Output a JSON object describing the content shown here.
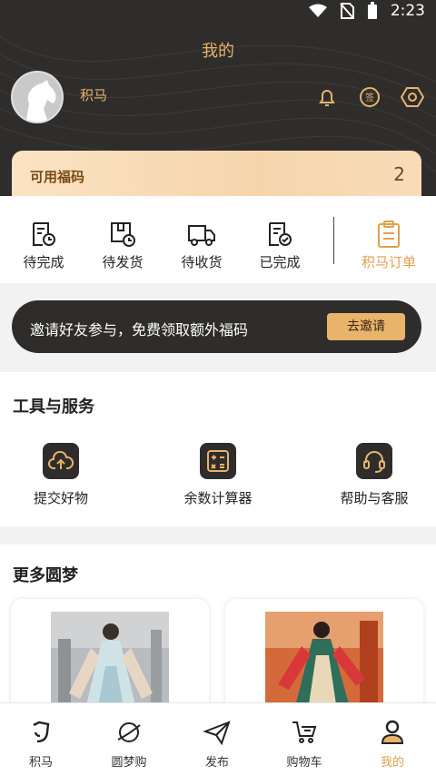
{
  "status_bar": {
    "time": "2:23"
  },
  "header": {
    "title": "我的",
    "username": "积马"
  },
  "fuma": {
    "label": "可用福码",
    "count": "2"
  },
  "orders": {
    "items": [
      {
        "label": "待完成",
        "icon": "doc-clock-icon"
      },
      {
        "label": "待发货",
        "icon": "box-clock-icon"
      },
      {
        "label": "待收货",
        "icon": "truck-icon"
      },
      {
        "label": "已完成",
        "icon": "doc-check-icon"
      }
    ],
    "all_label": "积马订单"
  },
  "invite": {
    "text": "邀请好友参与，免费领取额外福码",
    "button": "去邀请"
  },
  "tools": {
    "title": "工具与服务",
    "items": [
      {
        "label": "提交好物",
        "icon": "cloud-upload-icon"
      },
      {
        "label": "余数计算器",
        "icon": "calculator-icon"
      },
      {
        "label": "帮助与客服",
        "icon": "headset-icon"
      }
    ]
  },
  "more": {
    "title": "更多圆梦"
  },
  "tabbar": {
    "items": [
      {
        "label": "积马",
        "icon": "jima-logo-icon"
      },
      {
        "label": "圆梦购",
        "icon": "planet-icon"
      },
      {
        "label": "发布",
        "icon": "paper-plane-icon"
      },
      {
        "label": "购物车",
        "icon": "cart-icon"
      },
      {
        "label": "我的",
        "icon": "user-icon"
      }
    ]
  },
  "colors": {
    "accent": "#e8b36a",
    "dark": "#2e2d2c"
  }
}
